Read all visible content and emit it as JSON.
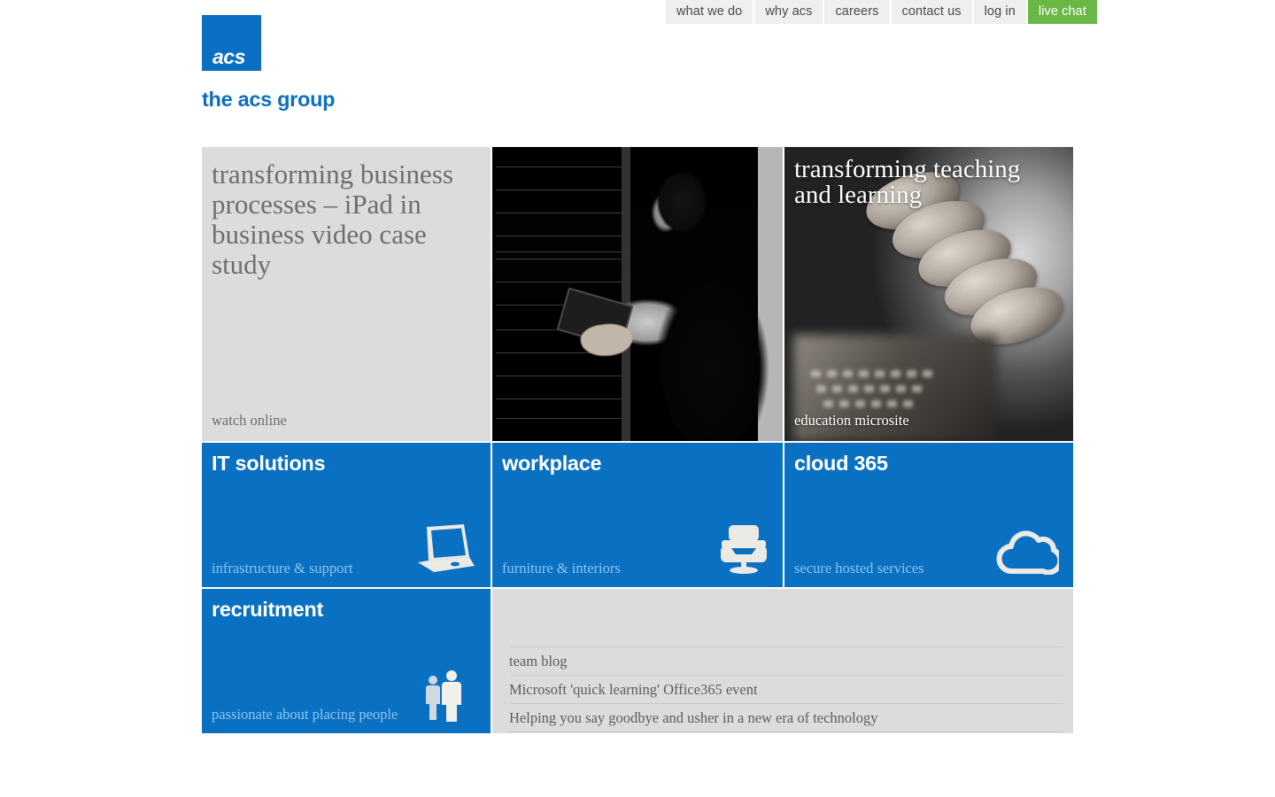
{
  "brand": {
    "logo_mark_text": "acs",
    "logo_title": "the acs group",
    "blue": "#0a70c2",
    "green": "#6bb745",
    "gray": "#dcdcdc"
  },
  "nav": {
    "items": [
      {
        "label": "what we do",
        "style": "default"
      },
      {
        "label": "why acs",
        "style": "default"
      },
      {
        "label": "careers",
        "style": "default"
      },
      {
        "label": "contact us",
        "style": "default"
      },
      {
        "label": "log in",
        "style": "default"
      },
      {
        "label": "live chat",
        "style": "highlight"
      }
    ]
  },
  "hero": {
    "case_study": {
      "headline": "transforming business processes – iPad in business video case study",
      "cta": "watch online"
    },
    "photo": {
      "alt": "technician-with-tablet-at-server-rack"
    },
    "education": {
      "headline": "transforming teaching and learning",
      "cta": "education microsite",
      "alt": "girl-with-braided-hair-using-tablet"
    }
  },
  "tiles": [
    {
      "title": "IT solutions",
      "subtitle": "infrastructure & support",
      "icon": "laptop-icon"
    },
    {
      "title": "workplace",
      "subtitle": "furniture & interiors",
      "icon": "armchair-icon"
    },
    {
      "title": "cloud 365",
      "subtitle": "secure hosted services",
      "icon": "cloud-icon"
    },
    {
      "title": "recruitment",
      "subtitle": "passionate about placing people",
      "icon": "people-icon"
    }
  ],
  "blog": {
    "items": [
      "team blog",
      "Microsoft 'quick learning' Office365 event",
      "Helping you say goodbye and usher in a new era of technology"
    ]
  }
}
